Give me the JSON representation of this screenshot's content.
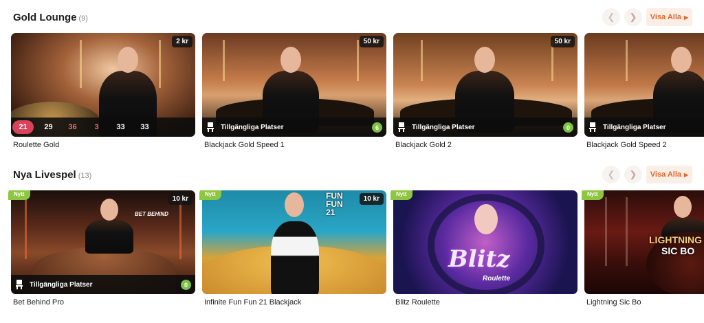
{
  "sections": [
    {
      "title": "Gold Lounge",
      "count": "(9)",
      "visa_label": "Visa Alla",
      "cards": [
        {
          "name": "Roulette Gold",
          "stake": "2 kr",
          "results": [
            "21",
            "29",
            "36",
            "3",
            "33",
            "33"
          ]
        },
        {
          "name": "Blackjack Gold Speed 1",
          "stake": "50 kr",
          "seats_label": "Tillgängliga Platser",
          "seats": "6"
        },
        {
          "name": "Blackjack Gold 2",
          "stake": "50 kr",
          "seats_label": "Tillgängliga Platser",
          "seats": "0"
        },
        {
          "name": "Blackjack Gold Speed 2",
          "seats_label": "Tillgängliga Platser"
        }
      ]
    },
    {
      "title": "Nya Livespel",
      "count": "(13)",
      "visa_label": "Visa Alla",
      "cards": [
        {
          "name": "Bet Behind Pro",
          "badge": "Nytt",
          "stake": "10 kr",
          "seats_label": "Tillgängliga Platser",
          "seats": "0",
          "logo": "BET BEHIND"
        },
        {
          "name": "Infinite Fun Fun 21 Blackjack",
          "badge": "Nytt",
          "stake": "10 kr",
          "logo": "FUN FUN 21"
        },
        {
          "name": "Blitz Roulette",
          "badge": "Nytt",
          "logo": "Blitz",
          "logo_sub": "Roulette"
        },
        {
          "name": "Lightning Sic Bo",
          "badge": "Nytt",
          "logo": "LIGHTNING",
          "logo_sub": "SIC BO"
        }
      ]
    }
  ],
  "colors": {
    "accent": "#e06a2c",
    "accent_bg": "#fbeee6",
    "seat_badge": "#7cc243",
    "new_badge": "#8dc63f",
    "hot_number": "#d9435a"
  },
  "icons": {
    "prev": "chevron-left-icon",
    "next": "chevron-right-icon",
    "seat": "chair-icon"
  }
}
